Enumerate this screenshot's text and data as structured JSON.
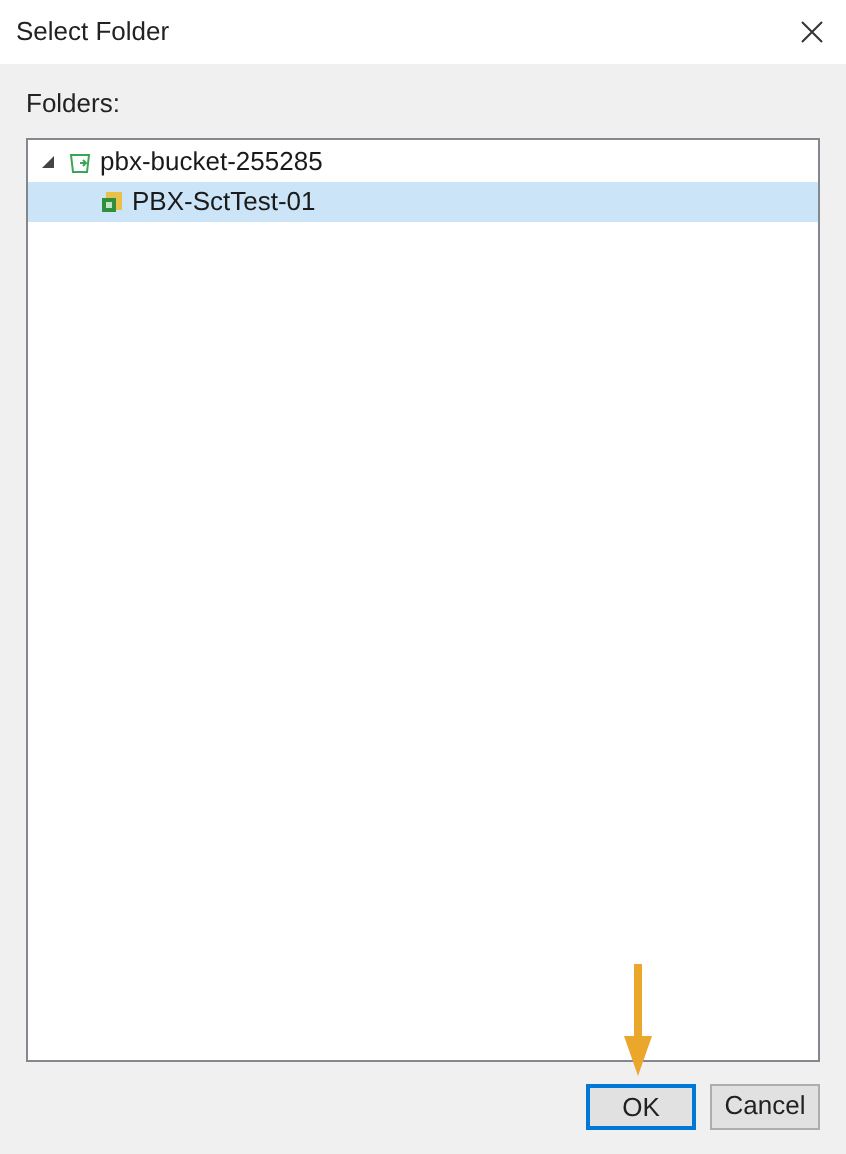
{
  "window": {
    "title": "Select Folder"
  },
  "folders_label": "Folders:",
  "tree": [
    {
      "label": "pbx-bucket-255285",
      "kind": "bucket",
      "expanded": true,
      "selected": false,
      "children": [
        {
          "label": "PBX-SctTest-01",
          "kind": "folder",
          "selected": true
        }
      ]
    }
  ],
  "buttons": [
    {
      "label": "OK",
      "default": true
    },
    {
      "label": "Cancel",
      "default": false
    }
  ]
}
